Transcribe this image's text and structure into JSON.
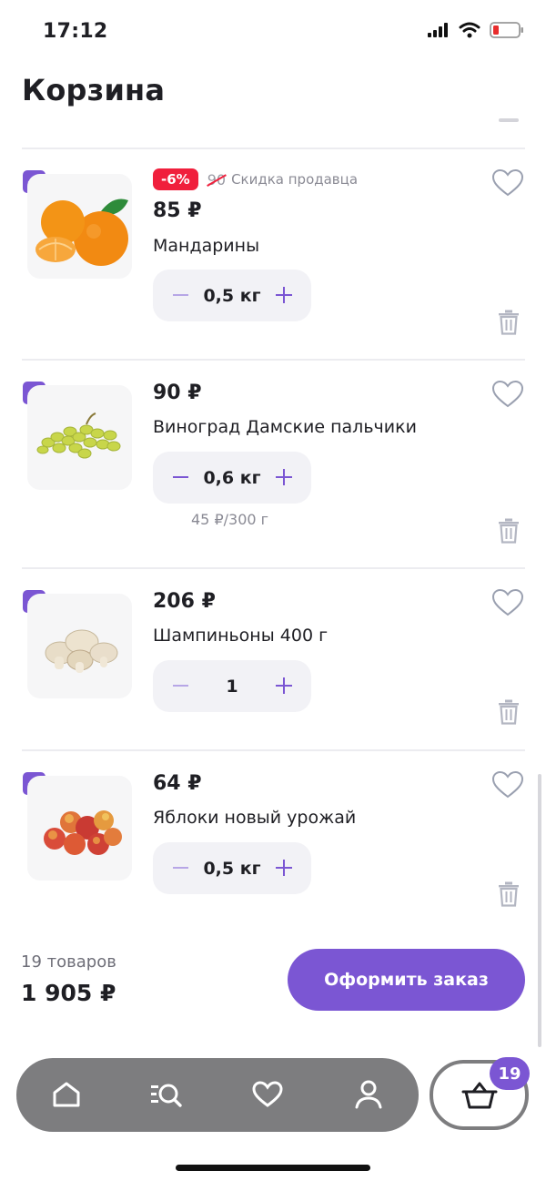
{
  "status_bar": {
    "time": "17:12"
  },
  "page_title": "Корзина",
  "items": [
    {
      "discount": "-6%",
      "old_price": "90",
      "discount_note": "Скидка продавца",
      "price": "85 ₽",
      "name": "Мандарины",
      "quantity": "0,5 кг",
      "unit_price": "",
      "image": "tangerines-image"
    },
    {
      "price": "90 ₽",
      "name": "Виноград Дамские пальчики",
      "quantity": "0,6 кг",
      "unit_price": "45 ₽/300 г",
      "image": "grapes-image"
    },
    {
      "price": "206 ₽",
      "name": "Шампиньоны 400 г",
      "quantity": "1",
      "unit_price": "",
      "image": "mushrooms-image"
    },
    {
      "price": "64 ₽",
      "name": "Яблоки новый урожай",
      "quantity": "0,5 кг",
      "unit_price": "",
      "image": "apples-image"
    }
  ],
  "summary": {
    "count": "19 товаров",
    "total": "1 905 ₽",
    "checkout_label": "Оформить заказ"
  },
  "bottom_nav": {
    "items": [
      "home-icon",
      "catalog-search-icon",
      "favorites-icon",
      "profile-icon"
    ],
    "cart_icon": "basket-icon",
    "cart_badge": "19"
  },
  "colors": {
    "accent": "#7b56d3",
    "discount": "#f01f3c",
    "nav_background": "#7d7d7f"
  }
}
